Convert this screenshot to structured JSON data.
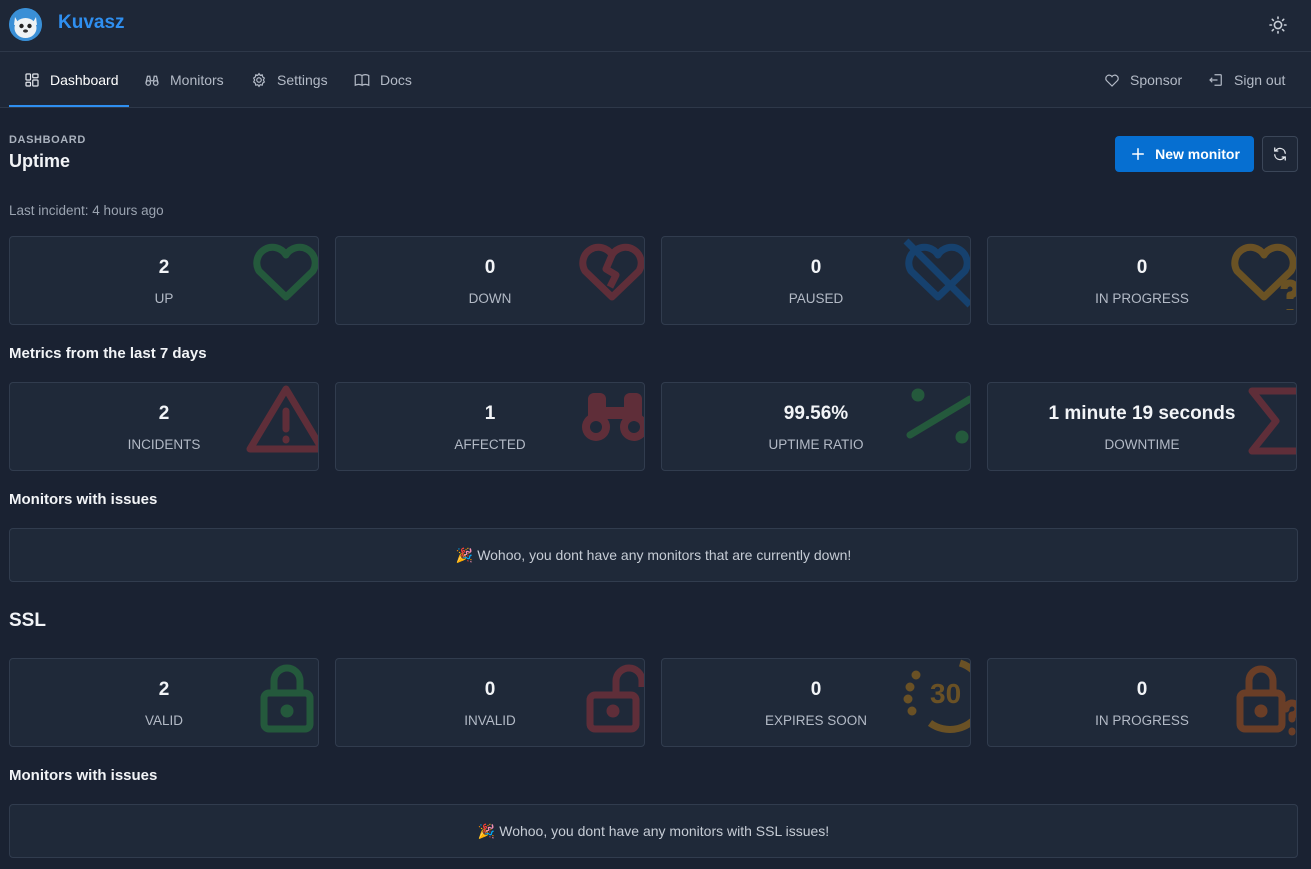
{
  "app": {
    "name": "Kuvasz",
    "logo_icon": "dog-logo-icon"
  },
  "nav": {
    "items": [
      {
        "label": "Dashboard",
        "icon": "dashboard-icon",
        "active": true
      },
      {
        "label": "Monitors",
        "icon": "binoculars-icon"
      },
      {
        "label": "Settings",
        "icon": "gear-icon"
      },
      {
        "label": "Docs",
        "icon": "book-icon"
      }
    ],
    "right": [
      {
        "label": "Sponsor",
        "icon": "heart-icon"
      },
      {
        "label": "Sign out",
        "icon": "logout-icon"
      }
    ]
  },
  "header": {
    "pretitle": "DASHBOARD",
    "title": "Uptime",
    "new_monitor": "New monitor",
    "last_incident": "Last incident: 4 hours ago"
  },
  "uptime_cards": [
    {
      "value": "2",
      "label": "UP",
      "color": "#2fb344"
    },
    {
      "value": "0",
      "label": "DOWN",
      "color": "#d63939"
    },
    {
      "value": "0",
      "label": "PAUSED",
      "color": "#066fd1"
    },
    {
      "value": "0",
      "label": "IN PROGRESS",
      "color": "#f59f00"
    }
  ],
  "metrics_title": "Metrics from the last 7 days",
  "metric_cards": [
    {
      "value": "2",
      "label": "INCIDENTS",
      "color": "#d63939"
    },
    {
      "value": "1",
      "label": "AFFECTED",
      "color": "#d63939"
    },
    {
      "value": "99.56%",
      "label": "UPTIME RATIO",
      "color": "#2fb344"
    },
    {
      "value": "1 minute 19 seconds",
      "label": "DOWNTIME",
      "color": "#d63939"
    }
  ],
  "issues1": {
    "title": "Monitors with issues",
    "message": "Wohoo, you dont have any monitors that are currently down!"
  },
  "ssl": {
    "title": "SSL",
    "cards": [
      {
        "value": "2",
        "label": "VALID",
        "color": "#2fb344"
      },
      {
        "value": "0",
        "label": "INVALID",
        "color": "#d63939"
      },
      {
        "value": "0",
        "label": "EXPIRES SOON",
        "color": "#f59f00",
        "badge": "30"
      },
      {
        "value": "0",
        "label": "IN PROGRESS",
        "color": "#f76707"
      }
    ]
  },
  "issues2": {
    "title": "Monitors with issues",
    "message": "Wohoo, you dont have any monitors with SSL issues!"
  },
  "celebrate_emoji": "🎉"
}
